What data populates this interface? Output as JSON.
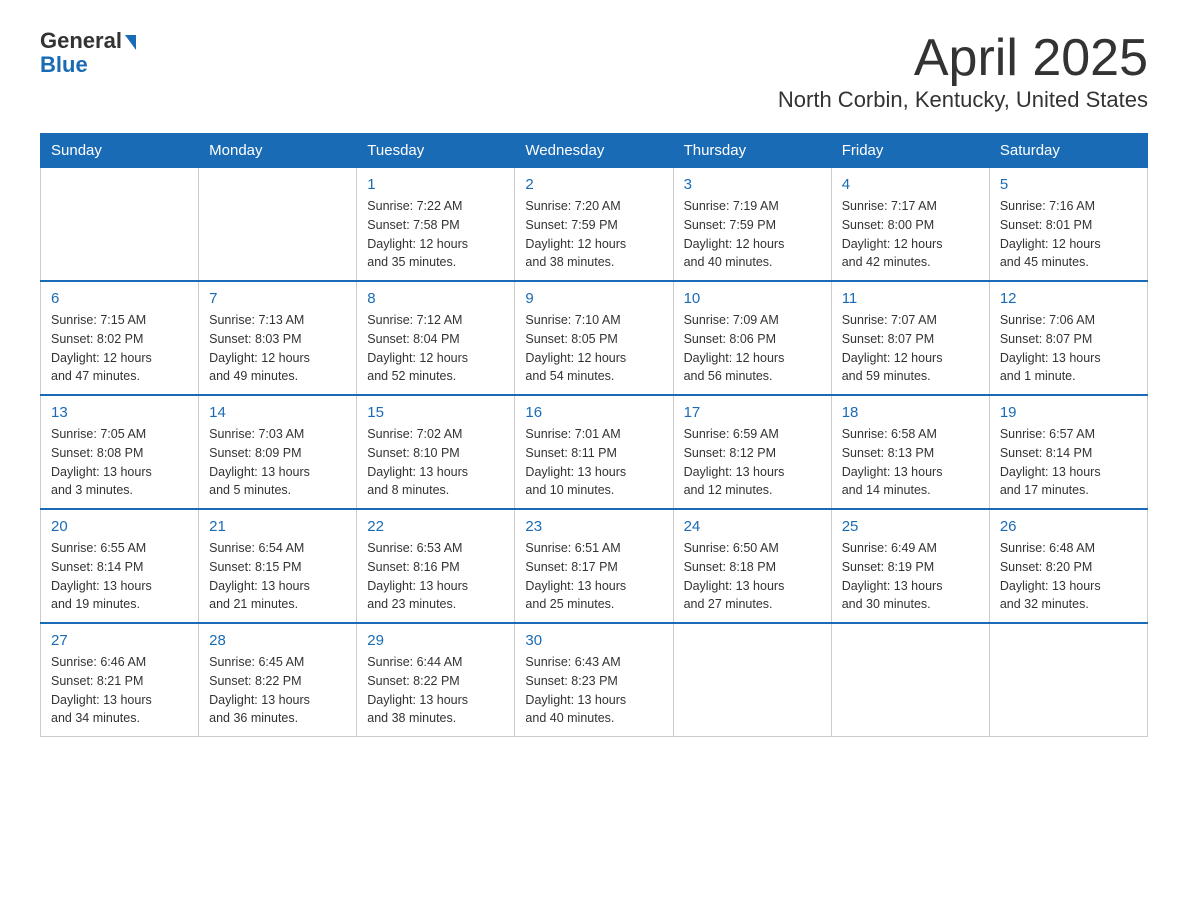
{
  "header": {
    "logo_line1": "General",
    "logo_line2": "Blue",
    "title": "April 2025",
    "subtitle": "North Corbin, Kentucky, United States"
  },
  "calendar": {
    "headers": [
      "Sunday",
      "Monday",
      "Tuesday",
      "Wednesday",
      "Thursday",
      "Friday",
      "Saturday"
    ],
    "weeks": [
      [
        {
          "day": "",
          "info": ""
        },
        {
          "day": "",
          "info": ""
        },
        {
          "day": "1",
          "info": "Sunrise: 7:22 AM\nSunset: 7:58 PM\nDaylight: 12 hours\nand 35 minutes."
        },
        {
          "day": "2",
          "info": "Sunrise: 7:20 AM\nSunset: 7:59 PM\nDaylight: 12 hours\nand 38 minutes."
        },
        {
          "day": "3",
          "info": "Sunrise: 7:19 AM\nSunset: 7:59 PM\nDaylight: 12 hours\nand 40 minutes."
        },
        {
          "day": "4",
          "info": "Sunrise: 7:17 AM\nSunset: 8:00 PM\nDaylight: 12 hours\nand 42 minutes."
        },
        {
          "day": "5",
          "info": "Sunrise: 7:16 AM\nSunset: 8:01 PM\nDaylight: 12 hours\nand 45 minutes."
        }
      ],
      [
        {
          "day": "6",
          "info": "Sunrise: 7:15 AM\nSunset: 8:02 PM\nDaylight: 12 hours\nand 47 minutes."
        },
        {
          "day": "7",
          "info": "Sunrise: 7:13 AM\nSunset: 8:03 PM\nDaylight: 12 hours\nand 49 minutes."
        },
        {
          "day": "8",
          "info": "Sunrise: 7:12 AM\nSunset: 8:04 PM\nDaylight: 12 hours\nand 52 minutes."
        },
        {
          "day": "9",
          "info": "Sunrise: 7:10 AM\nSunset: 8:05 PM\nDaylight: 12 hours\nand 54 minutes."
        },
        {
          "day": "10",
          "info": "Sunrise: 7:09 AM\nSunset: 8:06 PM\nDaylight: 12 hours\nand 56 minutes."
        },
        {
          "day": "11",
          "info": "Sunrise: 7:07 AM\nSunset: 8:07 PM\nDaylight: 12 hours\nand 59 minutes."
        },
        {
          "day": "12",
          "info": "Sunrise: 7:06 AM\nSunset: 8:07 PM\nDaylight: 13 hours\nand 1 minute."
        }
      ],
      [
        {
          "day": "13",
          "info": "Sunrise: 7:05 AM\nSunset: 8:08 PM\nDaylight: 13 hours\nand 3 minutes."
        },
        {
          "day": "14",
          "info": "Sunrise: 7:03 AM\nSunset: 8:09 PM\nDaylight: 13 hours\nand 5 minutes."
        },
        {
          "day": "15",
          "info": "Sunrise: 7:02 AM\nSunset: 8:10 PM\nDaylight: 13 hours\nand 8 minutes."
        },
        {
          "day": "16",
          "info": "Sunrise: 7:01 AM\nSunset: 8:11 PM\nDaylight: 13 hours\nand 10 minutes."
        },
        {
          "day": "17",
          "info": "Sunrise: 6:59 AM\nSunset: 8:12 PM\nDaylight: 13 hours\nand 12 minutes."
        },
        {
          "day": "18",
          "info": "Sunrise: 6:58 AM\nSunset: 8:13 PM\nDaylight: 13 hours\nand 14 minutes."
        },
        {
          "day": "19",
          "info": "Sunrise: 6:57 AM\nSunset: 8:14 PM\nDaylight: 13 hours\nand 17 minutes."
        }
      ],
      [
        {
          "day": "20",
          "info": "Sunrise: 6:55 AM\nSunset: 8:14 PM\nDaylight: 13 hours\nand 19 minutes."
        },
        {
          "day": "21",
          "info": "Sunrise: 6:54 AM\nSunset: 8:15 PM\nDaylight: 13 hours\nand 21 minutes."
        },
        {
          "day": "22",
          "info": "Sunrise: 6:53 AM\nSunset: 8:16 PM\nDaylight: 13 hours\nand 23 minutes."
        },
        {
          "day": "23",
          "info": "Sunrise: 6:51 AM\nSunset: 8:17 PM\nDaylight: 13 hours\nand 25 minutes."
        },
        {
          "day": "24",
          "info": "Sunrise: 6:50 AM\nSunset: 8:18 PM\nDaylight: 13 hours\nand 27 minutes."
        },
        {
          "day": "25",
          "info": "Sunrise: 6:49 AM\nSunset: 8:19 PM\nDaylight: 13 hours\nand 30 minutes."
        },
        {
          "day": "26",
          "info": "Sunrise: 6:48 AM\nSunset: 8:20 PM\nDaylight: 13 hours\nand 32 minutes."
        }
      ],
      [
        {
          "day": "27",
          "info": "Sunrise: 6:46 AM\nSunset: 8:21 PM\nDaylight: 13 hours\nand 34 minutes."
        },
        {
          "day": "28",
          "info": "Sunrise: 6:45 AM\nSunset: 8:22 PM\nDaylight: 13 hours\nand 36 minutes."
        },
        {
          "day": "29",
          "info": "Sunrise: 6:44 AM\nSunset: 8:22 PM\nDaylight: 13 hours\nand 38 minutes."
        },
        {
          "day": "30",
          "info": "Sunrise: 6:43 AM\nSunset: 8:23 PM\nDaylight: 13 hours\nand 40 minutes."
        },
        {
          "day": "",
          "info": ""
        },
        {
          "day": "",
          "info": ""
        },
        {
          "day": "",
          "info": ""
        }
      ]
    ]
  }
}
